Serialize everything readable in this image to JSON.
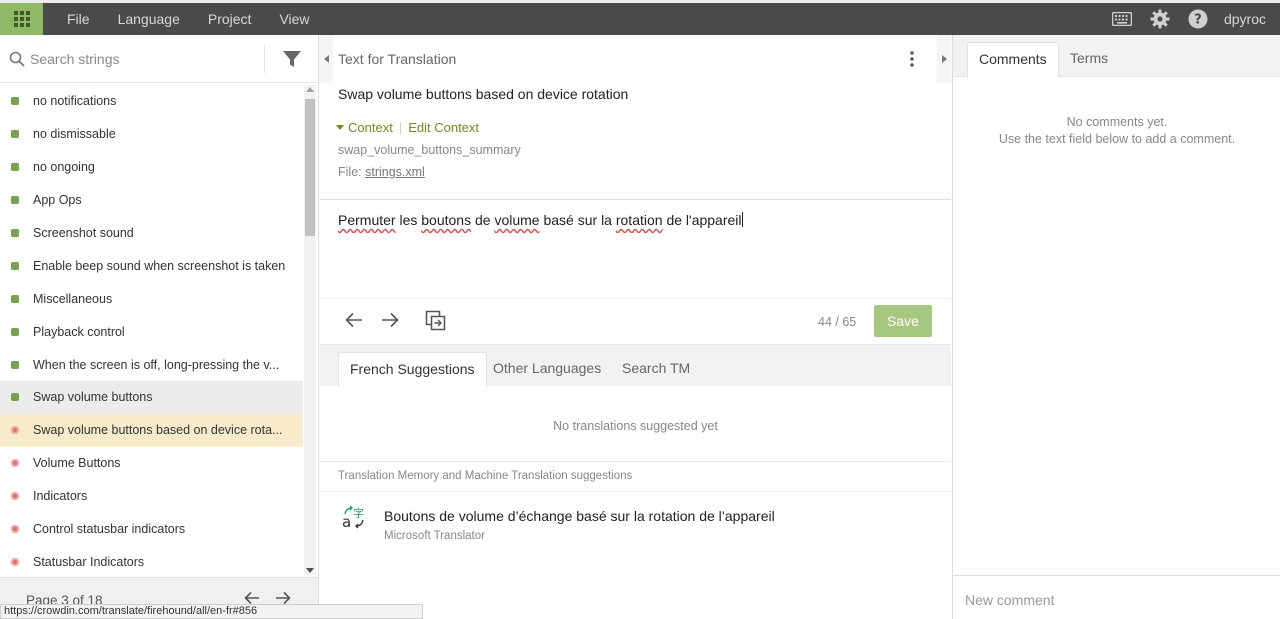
{
  "topbar": {
    "menu": [
      "File",
      "Language",
      "Project",
      "View"
    ],
    "user": "dpyroc"
  },
  "left": {
    "search_placeholder": "Search strings",
    "items": [
      {
        "label": "no notifications",
        "status": "translated"
      },
      {
        "label": "no dismissable",
        "status": "translated"
      },
      {
        "label": "no ongoing",
        "status": "translated"
      },
      {
        "label": "App Ops",
        "status": "translated"
      },
      {
        "label": "Screenshot sound",
        "status": "translated"
      },
      {
        "label": "Enable beep sound when screenshot is taken",
        "status": "translated"
      },
      {
        "label": "Miscellaneous",
        "status": "translated"
      },
      {
        "label": "Playback control",
        "status": "translated"
      },
      {
        "label": "When the screen is off, long-pressing the v...",
        "status": "translated"
      },
      {
        "label": "Swap volume buttons",
        "status": "translated"
      },
      {
        "label": "Swap volume buttons based on device rota...",
        "status": "untranslated"
      },
      {
        "label": "Volume Buttons",
        "status": "untranslated"
      },
      {
        "label": "Indicators",
        "status": "untranslated"
      },
      {
        "label": "Control statusbar indicators",
        "status": "untranslated"
      },
      {
        "label": "Statusbar Indicators",
        "status": "untranslated"
      }
    ],
    "pager": "Page 3 of 18",
    "status_url": "https://crowdin.com/translate/firehound/all/en-fr#856"
  },
  "center": {
    "source_header": "Text for Translation",
    "source_text": "Swap volume buttons based on device rotation",
    "context_label": "Context",
    "edit_context": "Edit Context",
    "context_key": "swap_volume_buttons_summary",
    "file_prefix": "File:",
    "file_name": "strings.xml",
    "translation": {
      "w1": "Permuter",
      "t1": " les ",
      "w2": "boutons",
      "t2": " de ",
      "w3": "volume",
      "t3": " basé sur la ",
      "w4": "rotation",
      "t4": " de l'appareil"
    },
    "char_count": "44 / 65",
    "save_label": "Save",
    "tabs": [
      "French Suggestions",
      "Other Languages",
      "Search TM"
    ],
    "no_suggestions": "No translations suggested yet",
    "tm_header": "Translation Memory and Machine Translation suggestions",
    "mt_suggestion": "Boutons de volume d’échange basé sur la rotation de l’appareil",
    "mt_source": "Microsoft Translator"
  },
  "right": {
    "tabs": [
      "Comments",
      "Terms"
    ],
    "no_comments": "No comments yet.",
    "no_comments_hint": "Use the text field below to add a comment.",
    "comment_placeholder": "New comment"
  },
  "colors": {
    "accent_green": "#8fb867",
    "save_green": "#a6c77e",
    "topbar": "#4a4a4a",
    "translated": "#77a34a",
    "untranslated": "#e86a6a",
    "active_row": "#f7ebcb"
  }
}
